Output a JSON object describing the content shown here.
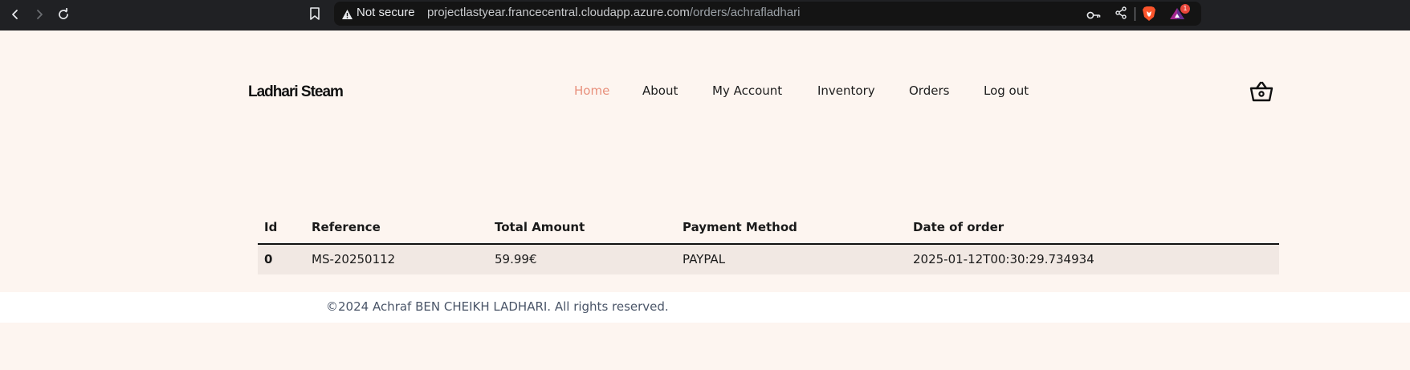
{
  "browser": {
    "security_label": "Not secure",
    "url_host": "projectlastyear.francecentral.cloudapp.azure.com",
    "url_path": "/orders/achrafladhari",
    "notification_count": "1",
    "icons": [
      "back-icon",
      "forward-icon",
      "reload-icon",
      "bookmark-icon",
      "warning-icon",
      "key-icon",
      "share-icon",
      "brave-shield-icon",
      "brave-rewards-icon"
    ]
  },
  "site": {
    "brand": "Ladhari Steam",
    "nav": [
      {
        "label": "Home",
        "active": true
      },
      {
        "label": "About"
      },
      {
        "label": "My Account"
      },
      {
        "label": "Inventory"
      },
      {
        "label": "Orders"
      },
      {
        "label": "Log out"
      }
    ],
    "accent_color": "#e8907c"
  },
  "orders_table": {
    "headers": [
      "Id",
      "Reference",
      "Total Amount",
      "Payment Method",
      "Date of order"
    ],
    "rows": [
      [
        "0",
        "MS-20250112",
        "59.99€",
        "PAYPAL",
        "2025-01-12T00:30:29.734934"
      ]
    ]
  },
  "footer": {
    "text": "©2024 Achraf BEN CHEIKH LADHARI. All rights reserved."
  }
}
